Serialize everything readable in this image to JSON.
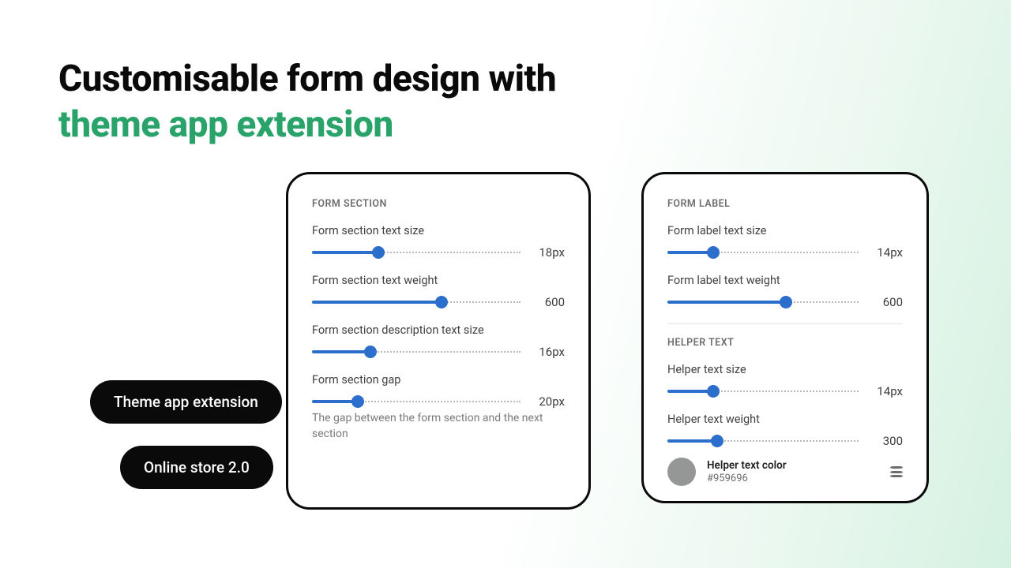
{
  "headline": {
    "line1": "Customisable form design with",
    "line2": "theme app extension"
  },
  "pills": {
    "theme_ext": "Theme app extension",
    "online_store": "Online store 2.0"
  },
  "panel_left": {
    "section_label": "FORM SECTION",
    "controls": {
      "text_size": {
        "label": "Form section text size",
        "value": "18px",
        "pct": 32
      },
      "text_weight": {
        "label": "Form section text weight",
        "value": "600",
        "pct": 62
      },
      "desc_size": {
        "label": "Form section description text size",
        "value": "16px",
        "pct": 28
      },
      "gap": {
        "label": "Form section gap",
        "value": "20px",
        "pct": 22,
        "help": "The gap between the form section and the next section"
      }
    }
  },
  "panel_right": {
    "section_a_label": "FORM LABEL",
    "section_b_label": "HELPER TEXT",
    "controls": {
      "label_size": {
        "label": "Form label text size",
        "value": "14px",
        "pct": 24
      },
      "label_weight": {
        "label": "Form label text weight",
        "value": "600",
        "pct": 62
      },
      "helper_size": {
        "label": "Helper text size",
        "value": "14px",
        "pct": 24
      },
      "helper_weight": {
        "label": "Helper text weight",
        "value": "300",
        "pct": 26
      }
    },
    "color": {
      "title": "Helper text color",
      "hex": "#959696"
    }
  }
}
